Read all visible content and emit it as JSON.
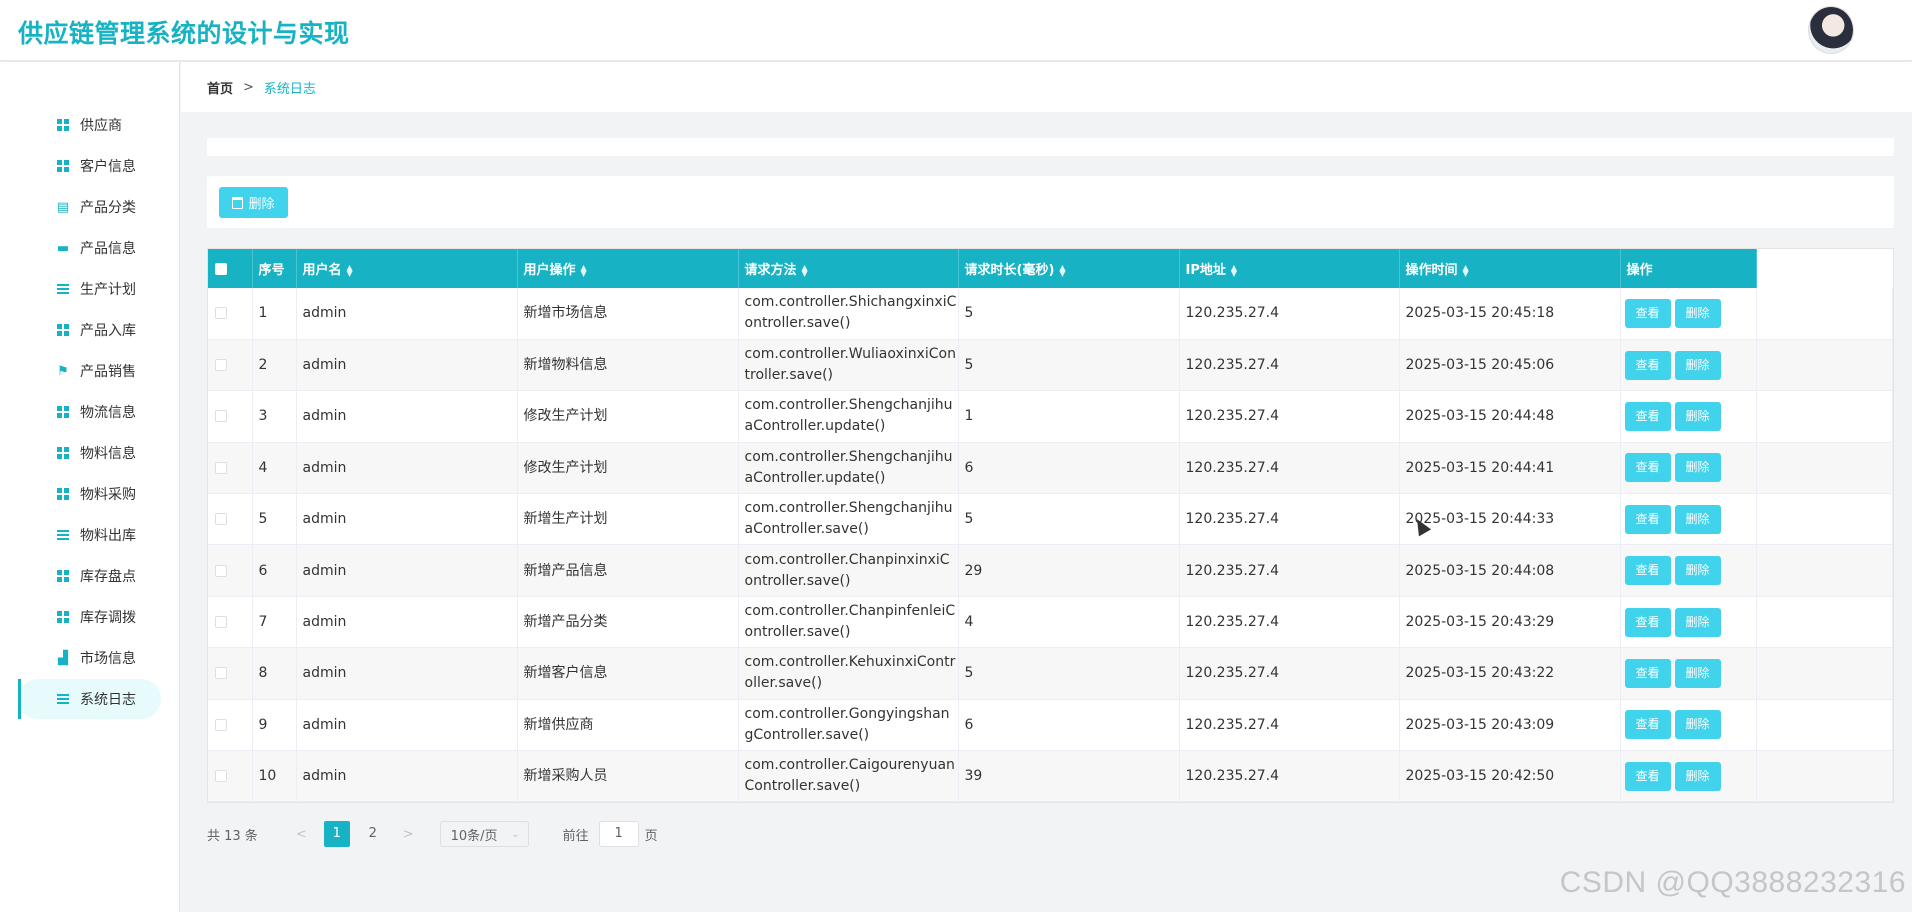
{
  "header": {
    "title": "供应链管理系统的设计与实现"
  },
  "sidebar": {
    "items": [
      {
        "label": "供应商",
        "icon": "grid-icon"
      },
      {
        "label": "客户信息",
        "icon": "grid-icon"
      },
      {
        "label": "产品分类",
        "icon": "clipboard-icon"
      },
      {
        "label": "产品信息",
        "icon": "monitor-icon"
      },
      {
        "label": "生产计划",
        "icon": "list-icon"
      },
      {
        "label": "产品入库",
        "icon": "grid-icon"
      },
      {
        "label": "产品销售",
        "icon": "flag-icon"
      },
      {
        "label": "物流信息",
        "icon": "grid-icon"
      },
      {
        "label": "物料信息",
        "icon": "grid-icon"
      },
      {
        "label": "物料采购",
        "icon": "grid-icon"
      },
      {
        "label": "物料出库",
        "icon": "list-icon"
      },
      {
        "label": "库存盘点",
        "icon": "grid-icon"
      },
      {
        "label": "库存调拨",
        "icon": "grid-icon"
      },
      {
        "label": "市场信息",
        "icon": "thumb-icon"
      },
      {
        "label": "系统日志",
        "icon": "sliders-icon",
        "active": true
      }
    ]
  },
  "breadcrumb": {
    "home": "首页",
    "separator": ">",
    "current": "系统日志"
  },
  "toolbar": {
    "delete_label": "删除"
  },
  "table": {
    "columns": [
      "序号",
      "用户名",
      "用户操作",
      "请求方法",
      "请求时长(毫秒)",
      "IP地址",
      "操作时间",
      "操作"
    ],
    "rows": [
      {
        "index": "1",
        "user": "admin",
        "operation": "新增市场信息",
        "method": "com.controller.ShichangxinxiController.save()",
        "duration": "5",
        "ip": "120.235.27.4",
        "time": "2025-03-15 20:45:18"
      },
      {
        "index": "2",
        "user": "admin",
        "operation": "新增物料信息",
        "method": "com.controller.WuliaoxinxiController.save()",
        "duration": "5",
        "ip": "120.235.27.4",
        "time": "2025-03-15 20:45:06"
      },
      {
        "index": "3",
        "user": "admin",
        "operation": "修改生产计划",
        "method": "com.controller.ShengchanjihuaController.update()",
        "duration": "1",
        "ip": "120.235.27.4",
        "time": "2025-03-15 20:44:48"
      },
      {
        "index": "4",
        "user": "admin",
        "operation": "修改生产计划",
        "method": "com.controller.ShengchanjihuaController.update()",
        "duration": "6",
        "ip": "120.235.27.4",
        "time": "2025-03-15 20:44:41"
      },
      {
        "index": "5",
        "user": "admin",
        "operation": "新增生产计划",
        "method": "com.controller.ShengchanjihuaController.save()",
        "duration": "5",
        "ip": "120.235.27.4",
        "time": "2025-03-15 20:44:33"
      },
      {
        "index": "6",
        "user": "admin",
        "operation": "新增产品信息",
        "method": "com.controller.ChanpinxinxiController.save()",
        "duration": "29",
        "ip": "120.235.27.4",
        "time": "2025-03-15 20:44:08"
      },
      {
        "index": "7",
        "user": "admin",
        "operation": "新增产品分类",
        "method": "com.controller.ChanpinfenleiController.save()",
        "duration": "4",
        "ip": "120.235.27.4",
        "time": "2025-03-15 20:43:29"
      },
      {
        "index": "8",
        "user": "admin",
        "operation": "新增客户信息",
        "method": "com.controller.KehuxinxiController.save()",
        "duration": "5",
        "ip": "120.235.27.4",
        "time": "2025-03-15 20:43:22"
      },
      {
        "index": "9",
        "user": "admin",
        "operation": "新增供应商",
        "method": "com.controller.GongyingshangController.save()",
        "duration": "6",
        "ip": "120.235.27.4",
        "time": "2025-03-15 20:43:09"
      },
      {
        "index": "10",
        "user": "admin",
        "operation": "新增采购人员",
        "method": "com.controller.CaigourenyuanController.save()",
        "duration": "39",
        "ip": "120.235.27.4",
        "time": "2025-03-15 20:42:50"
      }
    ],
    "view_label": "查看",
    "delete_label": "删除"
  },
  "pagination": {
    "total_text": "共 13 条",
    "prev": "<",
    "next": ">",
    "pages": [
      "1",
      "2"
    ],
    "current_page": "1",
    "page_size": "10条/页",
    "goto_label": "前往",
    "goto_value": "1",
    "page_unit": "页"
  },
  "watermark": "CSDN @QQ3888232316",
  "colors": {
    "accent": "#17b3c4",
    "button": "#41d3ec",
    "active_bg": "#e7fbfd"
  }
}
